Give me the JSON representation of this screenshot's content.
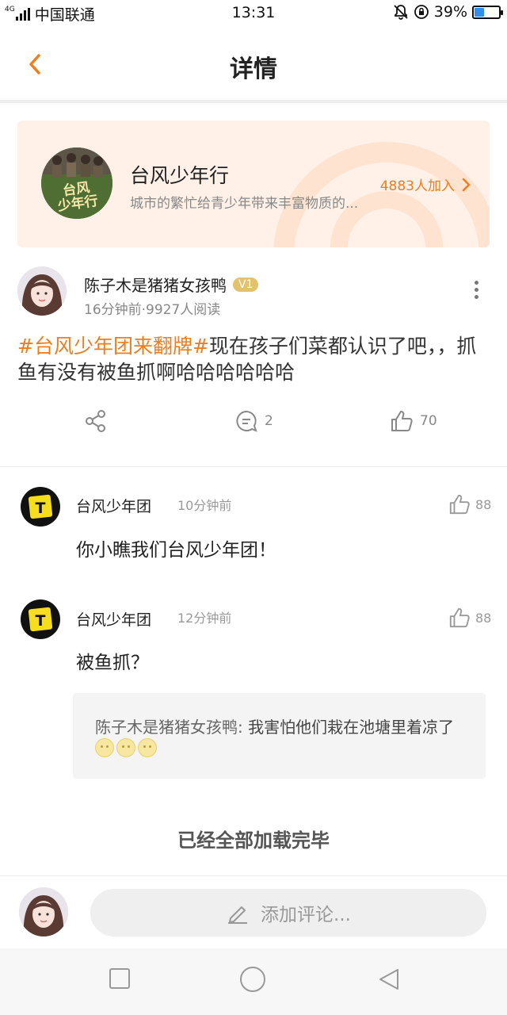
{
  "status_bar": {
    "network": "4G",
    "carrier": "中国联通",
    "time": "13:31",
    "battery_percent": "39%",
    "battery_level": 0.39
  },
  "header": {
    "title": "详情",
    "back_icon": "chevron-left-icon"
  },
  "topic": {
    "name": "台风少年行",
    "description": "城市的繁忙给青少年带来丰富物质的...",
    "join_label": "4883人加入",
    "avatar_text": "台风少年行"
  },
  "post": {
    "author": "陈子木是猪猪女孩鸭",
    "badge": "V1",
    "meta": "16分钟前·9927人阅读",
    "hashtag": "#台风少年团来翻牌#",
    "text": "现在孩子们菜都认识了吧，，抓鱼有没有被鱼抓啊哈哈哈哈哈哈",
    "share_icon": "share-icon",
    "comment_count": "2",
    "like_count": "70"
  },
  "comments": [
    {
      "author": "台风少年团",
      "time": "10分钟前",
      "likes": "88",
      "text": "你小瞧我们台风少年团！"
    },
    {
      "author": "台风少年团",
      "time": "12分钟前",
      "likes": "88",
      "text": "被鱼抓？",
      "reply": {
        "author": "陈子木是猪猪女孩鸭:",
        "text": " 我害怕他们栽在池塘里着凉了"
      }
    }
  ],
  "footer": {
    "loaded_text": "已经全部加载完毕",
    "input_placeholder": "添加评论..."
  },
  "colors": {
    "accent": "#f07d1c",
    "topic_bg": "#fff1e8",
    "badge": "#e3c26d"
  }
}
